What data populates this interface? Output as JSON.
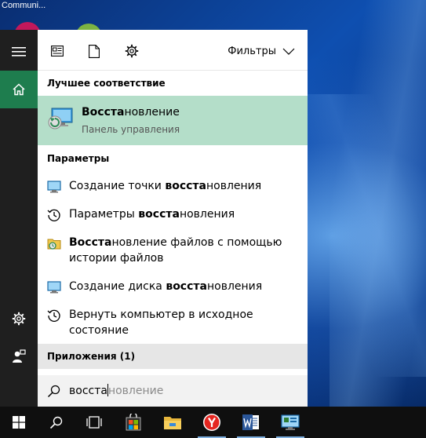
{
  "desktop": {
    "top_label": "Communi..."
  },
  "rail": {
    "items": [
      {
        "icon": "hamburger-menu-icon"
      },
      {
        "icon": "home-icon"
      },
      {
        "icon": "gear-icon"
      },
      {
        "icon": "feedback-person-icon"
      }
    ]
  },
  "search_panel": {
    "header": {
      "icons": [
        "news-icon",
        "document-icon",
        "gear-icon"
      ],
      "filters_label": "Фильтры"
    },
    "best_match": {
      "section_title": "Лучшее соответствие",
      "title_bold": "Восста",
      "title_rest": "новление",
      "subtitle": "Панель управления",
      "icon": "recovery-control-panel-icon"
    },
    "settings": {
      "section_title": "Параметры",
      "items": [
        {
          "icon": "monitor-icon",
          "pre": "Создание точки ",
          "bold": "восста",
          "post": "новления"
        },
        {
          "icon": "history-icon",
          "pre": "Параметры ",
          "bold": "восста",
          "post": "новления"
        },
        {
          "icon": "file-history-icon",
          "pre": "",
          "bold": "Восста",
          "post": "новление файлов с помощью истории файлов"
        },
        {
          "icon": "monitor-icon",
          "pre": "Создание диска ",
          "bold": "восста",
          "post": "новления"
        },
        {
          "icon": "history-icon",
          "pre": "Вернуть компьютер в исходное состояние",
          "bold": "",
          "post": ""
        }
      ]
    },
    "apps": {
      "section_title": "Приложения (1)"
    },
    "search": {
      "typed": "восста",
      "suggestion": "новление",
      "icon": "search-icon"
    }
  },
  "taskbar": {
    "items": [
      {
        "icon": "windows-start-icon"
      },
      {
        "icon": "search-icon"
      },
      {
        "icon": "task-view-icon"
      },
      {
        "icon": "store-icon"
      },
      {
        "icon": "file-explorer-icon"
      },
      {
        "icon": "yandex-browser-icon"
      },
      {
        "icon": "word-icon"
      },
      {
        "icon": "control-panel-icon"
      }
    ]
  },
  "colors": {
    "accent_green": "#1e7d4e",
    "best_match_bg": "#b4dec9",
    "rail_bg": "#1f1f1f",
    "taskbar_bg": "#0f0f0f"
  }
}
